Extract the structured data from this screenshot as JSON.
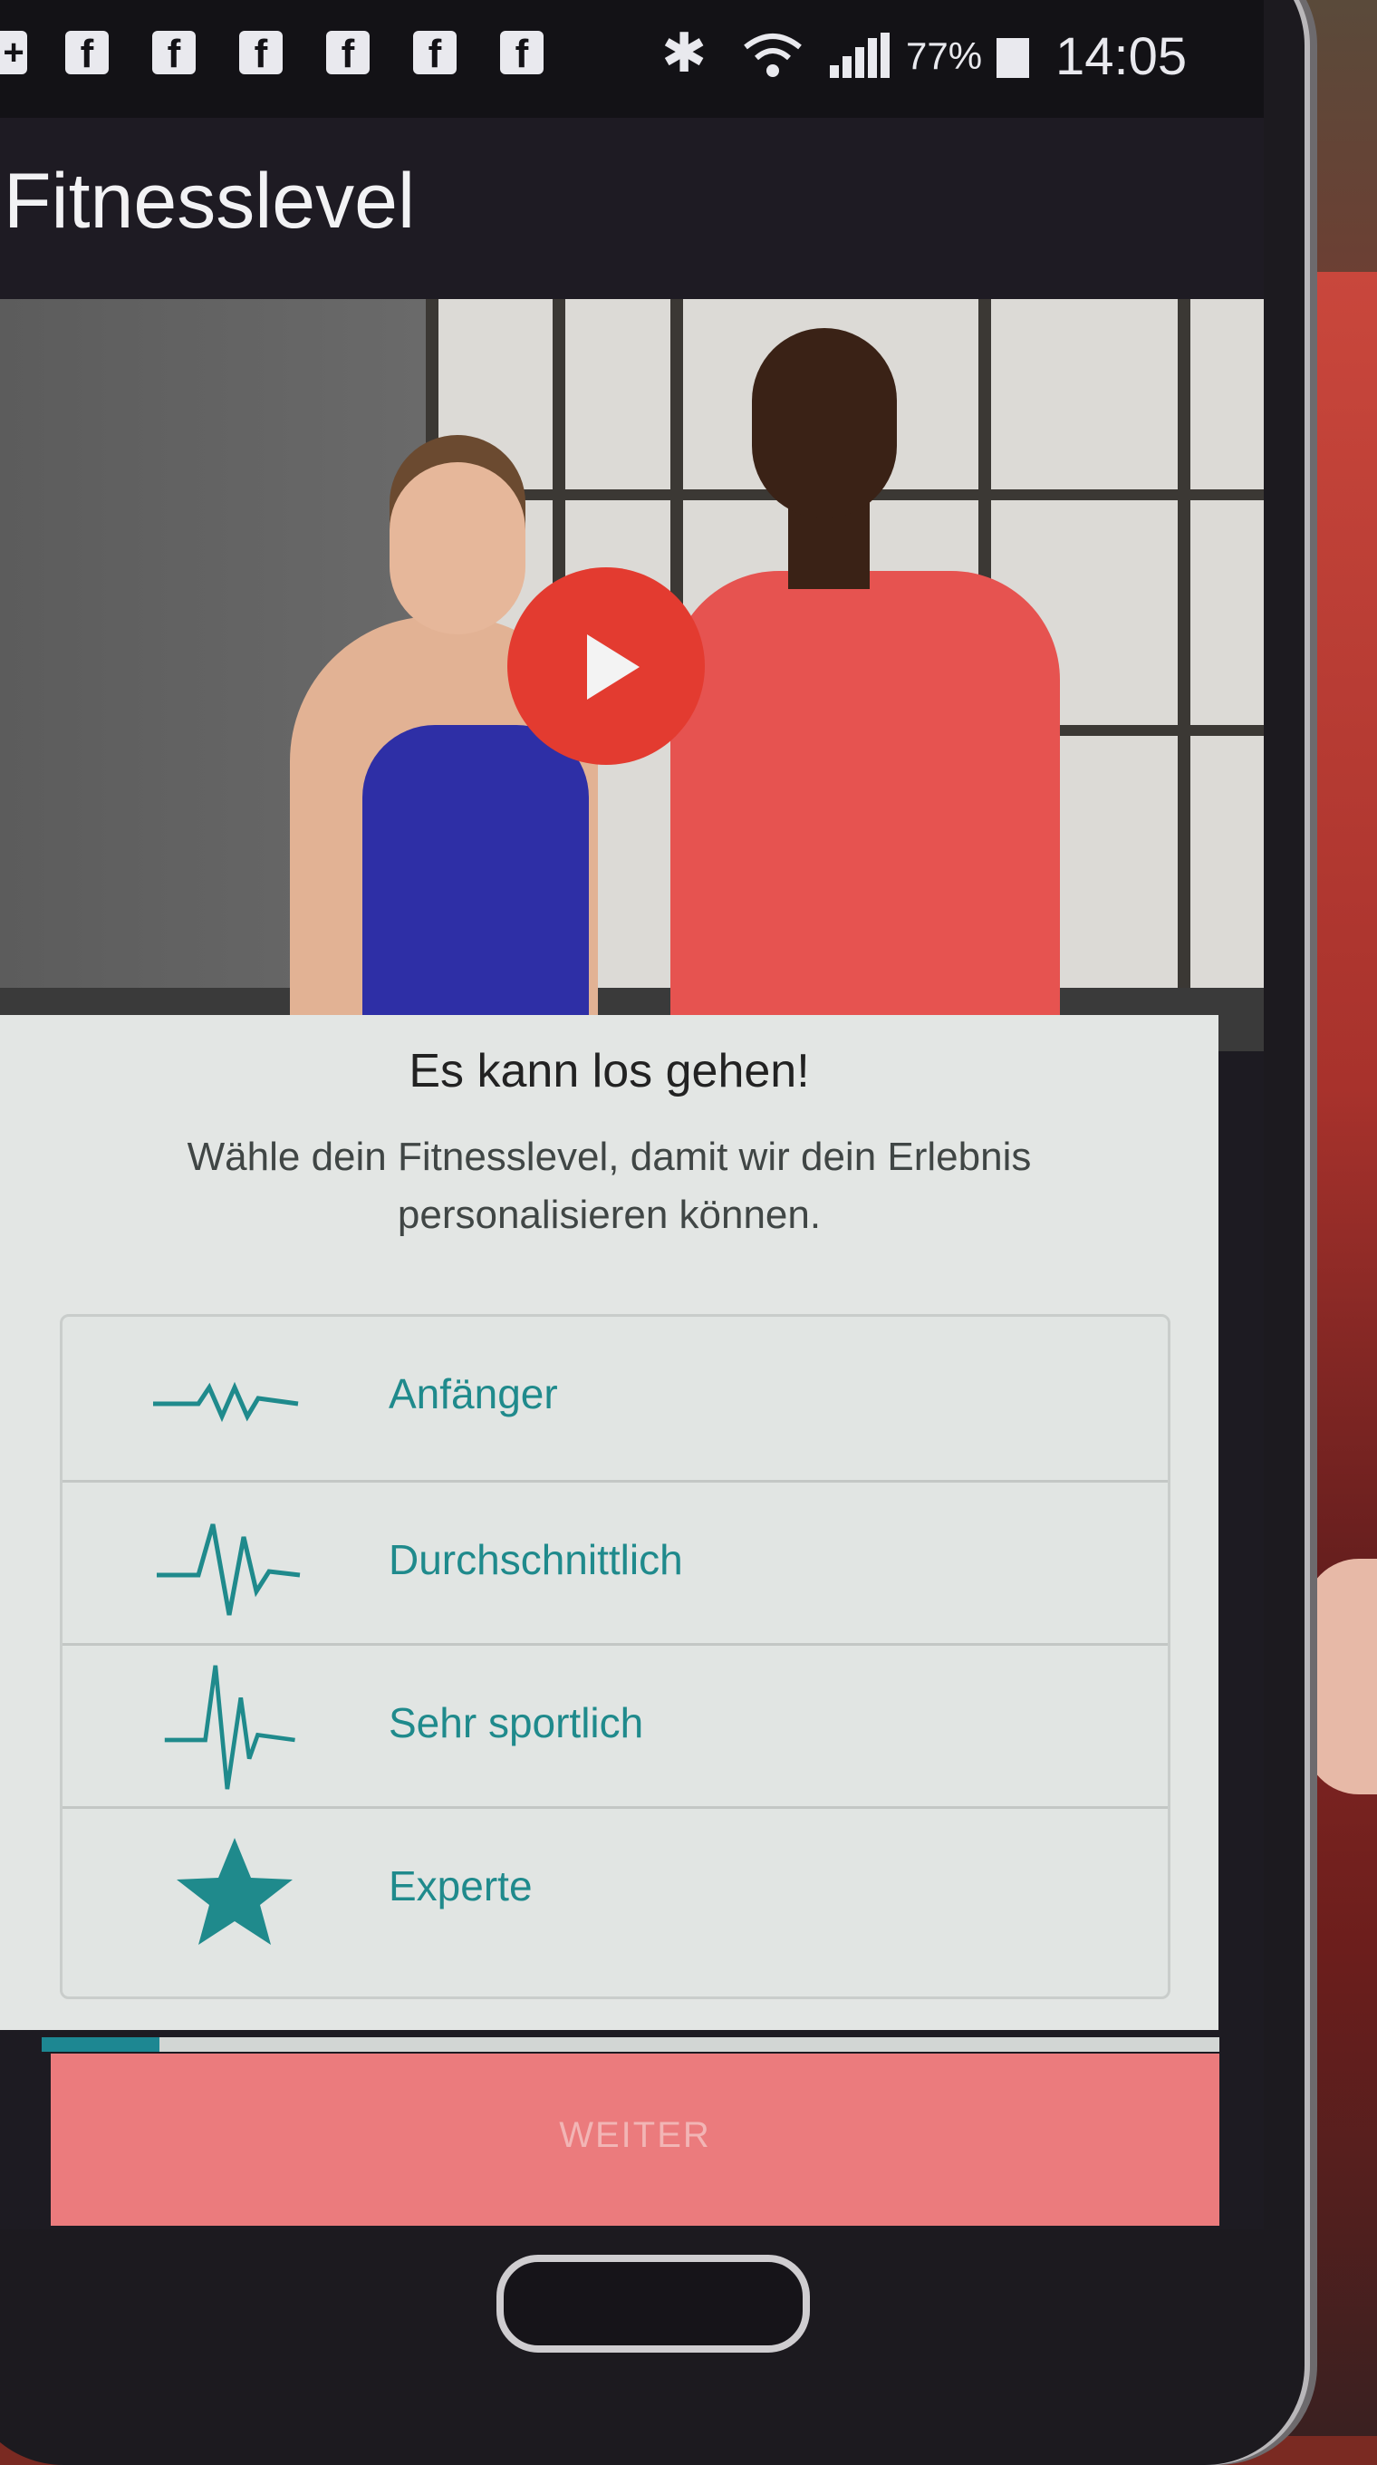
{
  "statusbar": {
    "notification_icons": [
      "facebook-icon",
      "facebook-icon",
      "facebook-icon",
      "facebook-icon",
      "facebook-icon",
      "facebook-icon"
    ],
    "battery_percent": "77%",
    "time": "14:05"
  },
  "appbar": {
    "title": "Fitnesslevel"
  },
  "hero": {
    "play_icon": "play-icon",
    "play_color": "#e33b30"
  },
  "intro": {
    "title": "Es kann los gehen!",
    "description": "Wähle dein Fitnesslevel, damit wir dein Erlebnis personalisieren können."
  },
  "levels": [
    {
      "label": "Anfänger",
      "icon": "heartbeat-low-icon"
    },
    {
      "label": "Durchschnittlich",
      "icon": "heartbeat-medium-icon"
    },
    {
      "label": "Sehr sportlich",
      "icon": "heartbeat-high-icon"
    },
    {
      "label": "Experte",
      "icon": "star-icon"
    }
  ],
  "progress": {
    "fraction": 0.1
  },
  "footer": {
    "next_label": "WEITER"
  },
  "colors": {
    "accent": "#1f8a8c",
    "button": "#eb7b7d",
    "play": "#e33b30"
  }
}
